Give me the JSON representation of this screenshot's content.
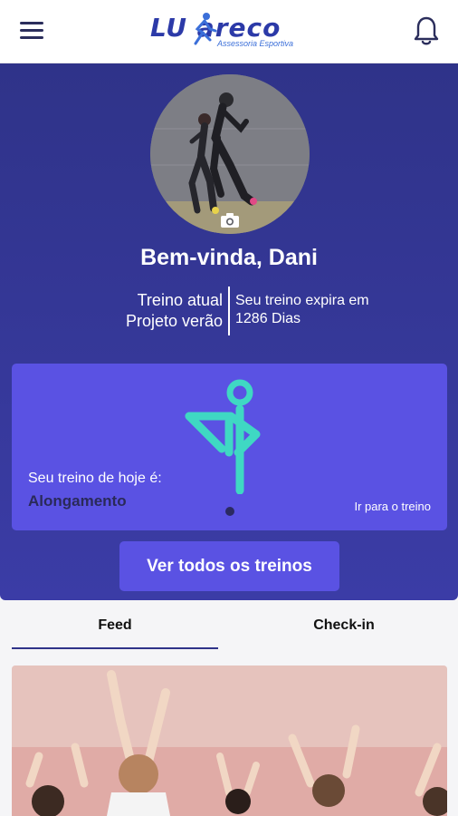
{
  "header": {
    "logo_text": "LU areco",
    "logo_subtitle": "Assessoria Esportiva",
    "menu_icon": "hamburger-menu-icon",
    "notification_icon": "bell-icon"
  },
  "profile": {
    "welcome": "Bem-vinda, Dani",
    "current_label": "Treino atual",
    "current_program": "Projeto verão",
    "expires_label": "Seu treino expira em",
    "expires_value": "1286 Dias",
    "camera_icon": "camera-icon"
  },
  "today": {
    "label": "Seu treino de hoje é:",
    "workout": "Alongamento",
    "link": "Ir para o treino",
    "icon": "stretching-person-icon"
  },
  "actions": {
    "all_workouts": "Ver todos os treinos"
  },
  "tabs": [
    {
      "label": "Feed",
      "active": true
    },
    {
      "label": "Check-in",
      "active": false
    }
  ],
  "colors": {
    "primary": "#3b3ca6",
    "card": "#5a52e3",
    "accent": "#3fd8c3",
    "brand_blue": "#2c3aa8"
  }
}
